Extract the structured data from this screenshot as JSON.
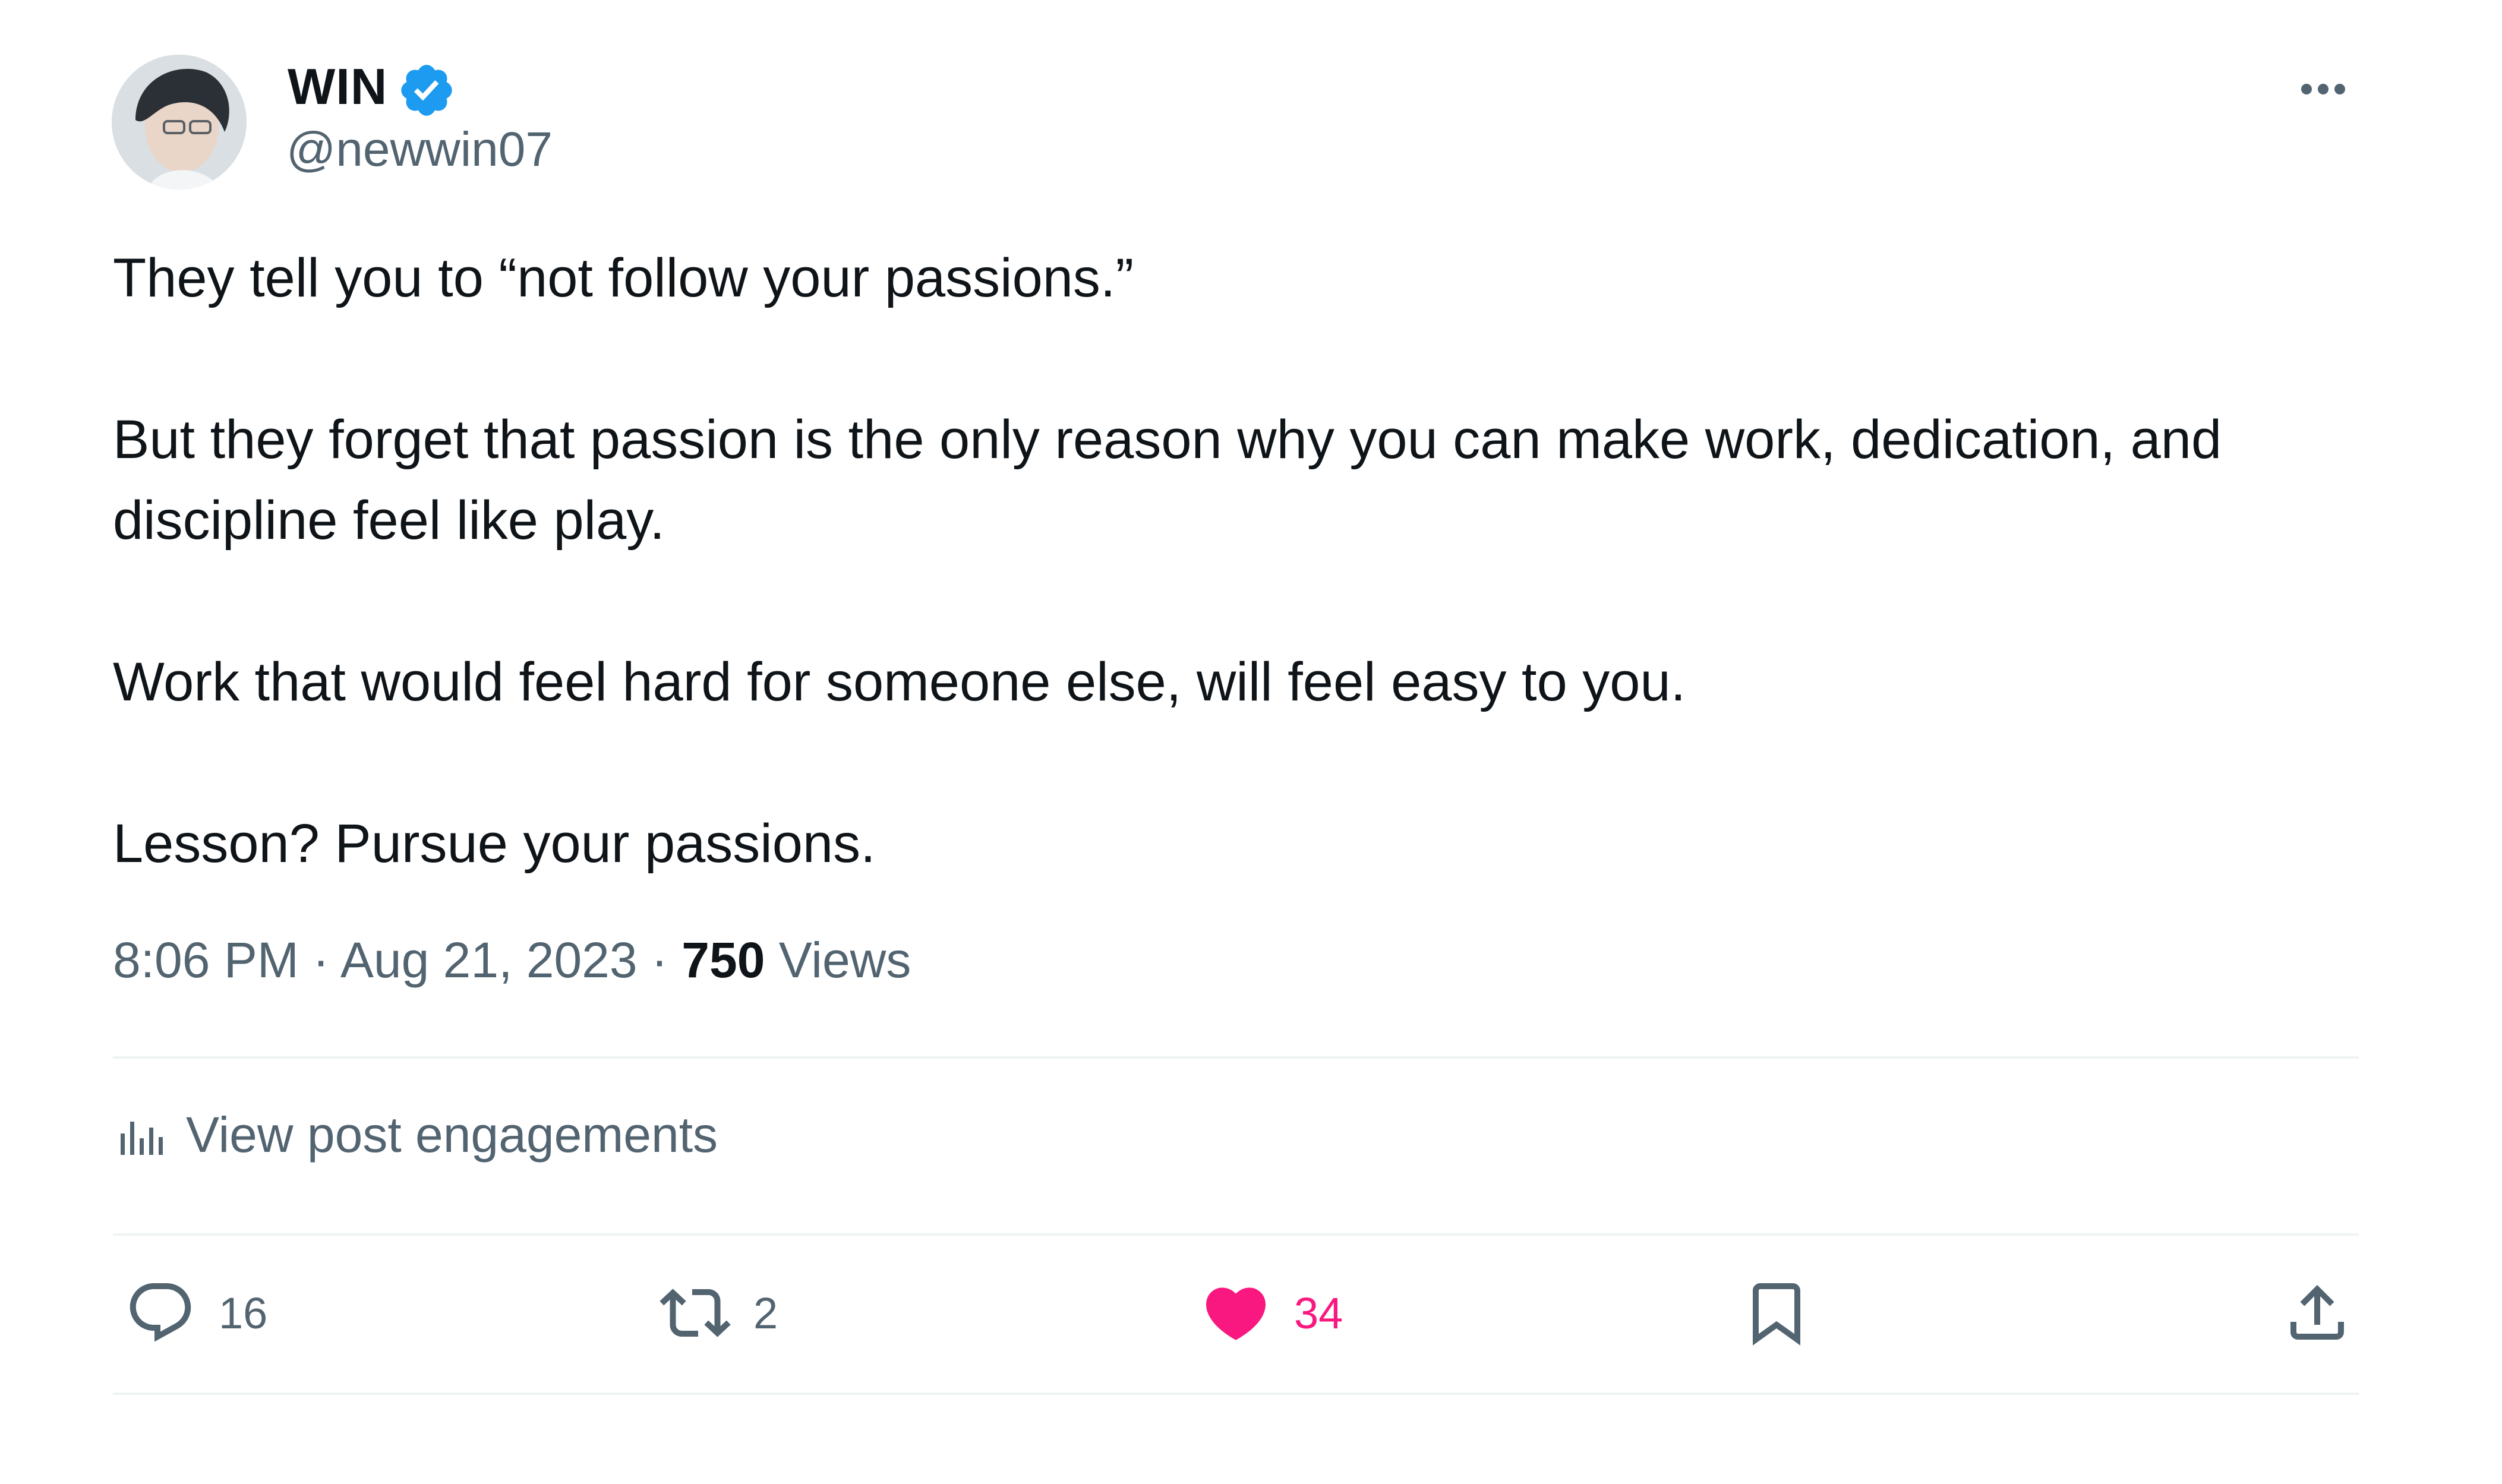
{
  "author": {
    "display_name": "WIN",
    "handle": "@newwin07",
    "verified": true,
    "avatar_icon": "profile-photo"
  },
  "more_icon": "more-horizontal-icon",
  "tweet": {
    "paragraphs": [
      "They tell you to “not follow your passions.”",
      "But they forget that passion is the only reason why you can make work, dedication, and discipline feel like play.",
      "Work that would feel hard for someone else, will feel easy to you.",
      "Lesson? Pursue your passions."
    ],
    "time": "8:06 PM",
    "separator": " · ",
    "date": "Aug 21, 2023",
    "views_count": "750",
    "views_label": " Views"
  },
  "engagements": {
    "label": "View post engagements",
    "icon": "analytics-icon"
  },
  "actions": {
    "reply_count": "16",
    "retweet_count": "2",
    "like_count": "34",
    "liked": true
  },
  "colors": {
    "text": "#0f1419",
    "secondary": "#536471",
    "verified": "#1d9bf0",
    "like": "#f91880",
    "divider": "#eff3f4"
  }
}
